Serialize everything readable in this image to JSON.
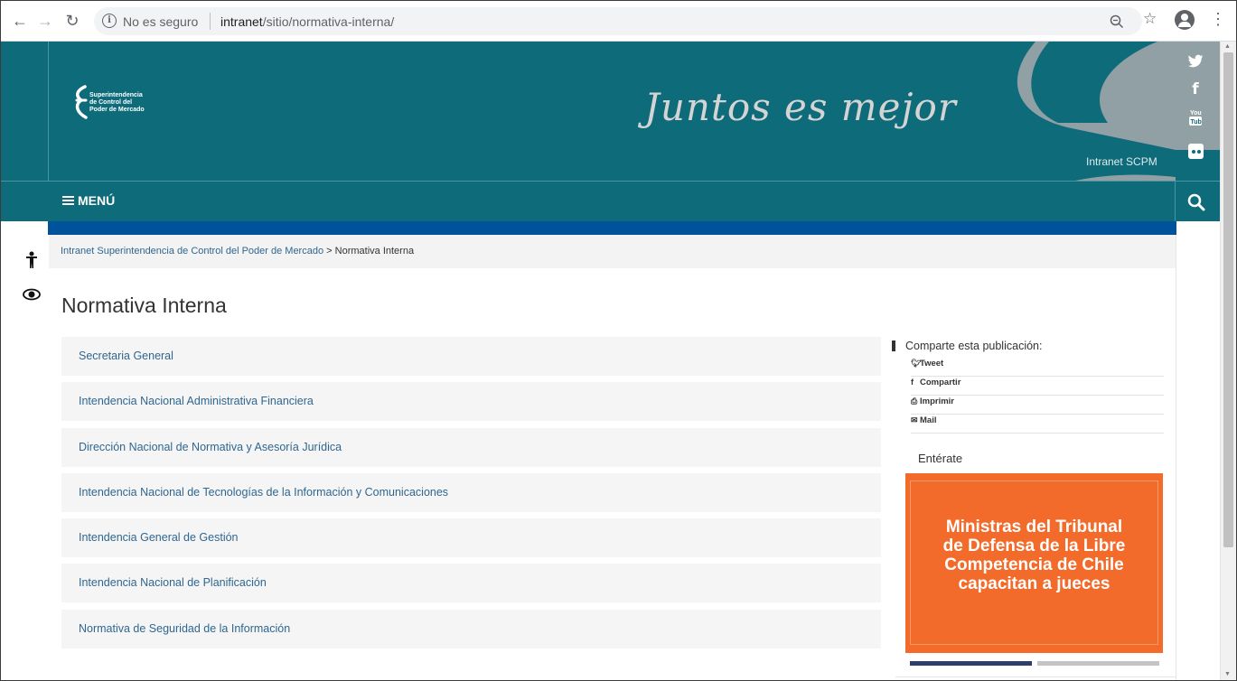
{
  "browser": {
    "security_label": "No es seguro",
    "url_host": "intranet",
    "url_path": "/sitio/normativa-interna/"
  },
  "header": {
    "logo_text_line1": "Superintendencia",
    "logo_text_line2": "de Control del",
    "logo_text_line3": "Poder de Mercado",
    "slogan": "Juntos es mejor",
    "intranet_label": "Intranet SCPM",
    "social": [
      "twitter-icon",
      "facebook-icon",
      "youtube-icon",
      "flickr-icon"
    ]
  },
  "menu": {
    "label": "MENÚ"
  },
  "breadcrumb": {
    "home_link": "Intranet Superintendencia de Control del Poder de Mercado",
    "separator": ">",
    "current": "Normativa Interna"
  },
  "main": {
    "title": "Normativa Interna",
    "items": [
      "Secretaria General",
      "Intendencia Nacional Administrativa Financiera",
      "Dirección Nacional de Normativa y Asesoría Jurídica",
      "Intendencia Nacional de Tecnologías de la Información y Comunicaciones",
      "Intendencia General de Gestión",
      "Intendencia Nacional de Planificación",
      "Normativa de Seguridad de la Información"
    ]
  },
  "share": {
    "title": "Comparte esta publicación:",
    "tweet": "Tweet",
    "compartir": "Compartir",
    "imprimir": "Imprimir",
    "mail": "Mail"
  },
  "sidebar": {
    "enterate": "Entérate",
    "promo_line1": "Ministras del Tribunal",
    "promo_line2": "de Defensa de la Libre",
    "promo_line3": "Competencia de Chile",
    "promo_line4": "capacitan a jueces"
  },
  "colors": {
    "header": "#0e6b7a",
    "strip": "#00529b",
    "link": "#2f6690",
    "promo": "#f26b2a"
  }
}
